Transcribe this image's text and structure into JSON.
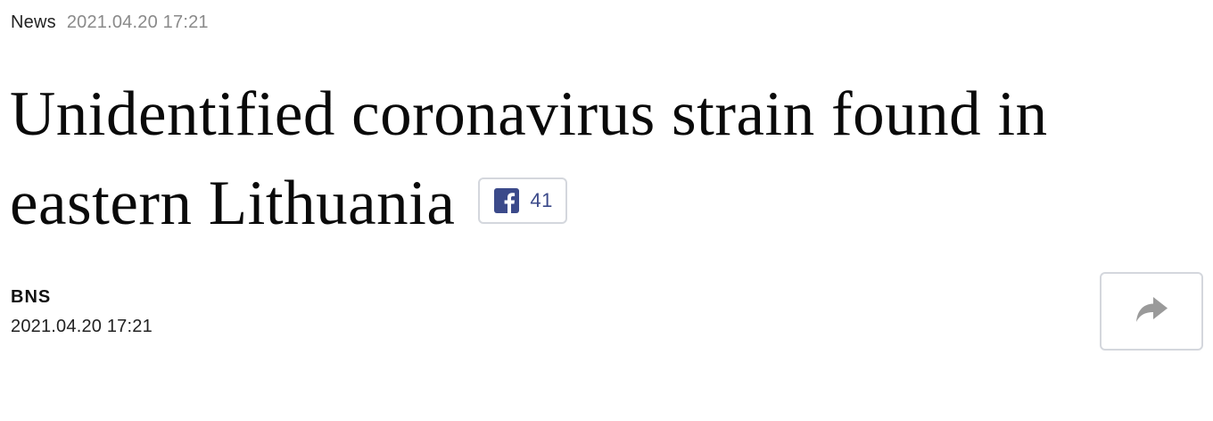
{
  "meta": {
    "category": "News",
    "timestamp": "2021.04.20 17:21"
  },
  "article": {
    "headline": "Unidentified coronavirus strain found in eastern Lithuania",
    "author": "BNS",
    "published": "2021.04.20 17:21"
  },
  "facebook": {
    "icon": "facebook-icon",
    "count": "41",
    "brand_color": "#3b4a8a"
  },
  "share": {
    "icon": "share-arrow-icon"
  }
}
